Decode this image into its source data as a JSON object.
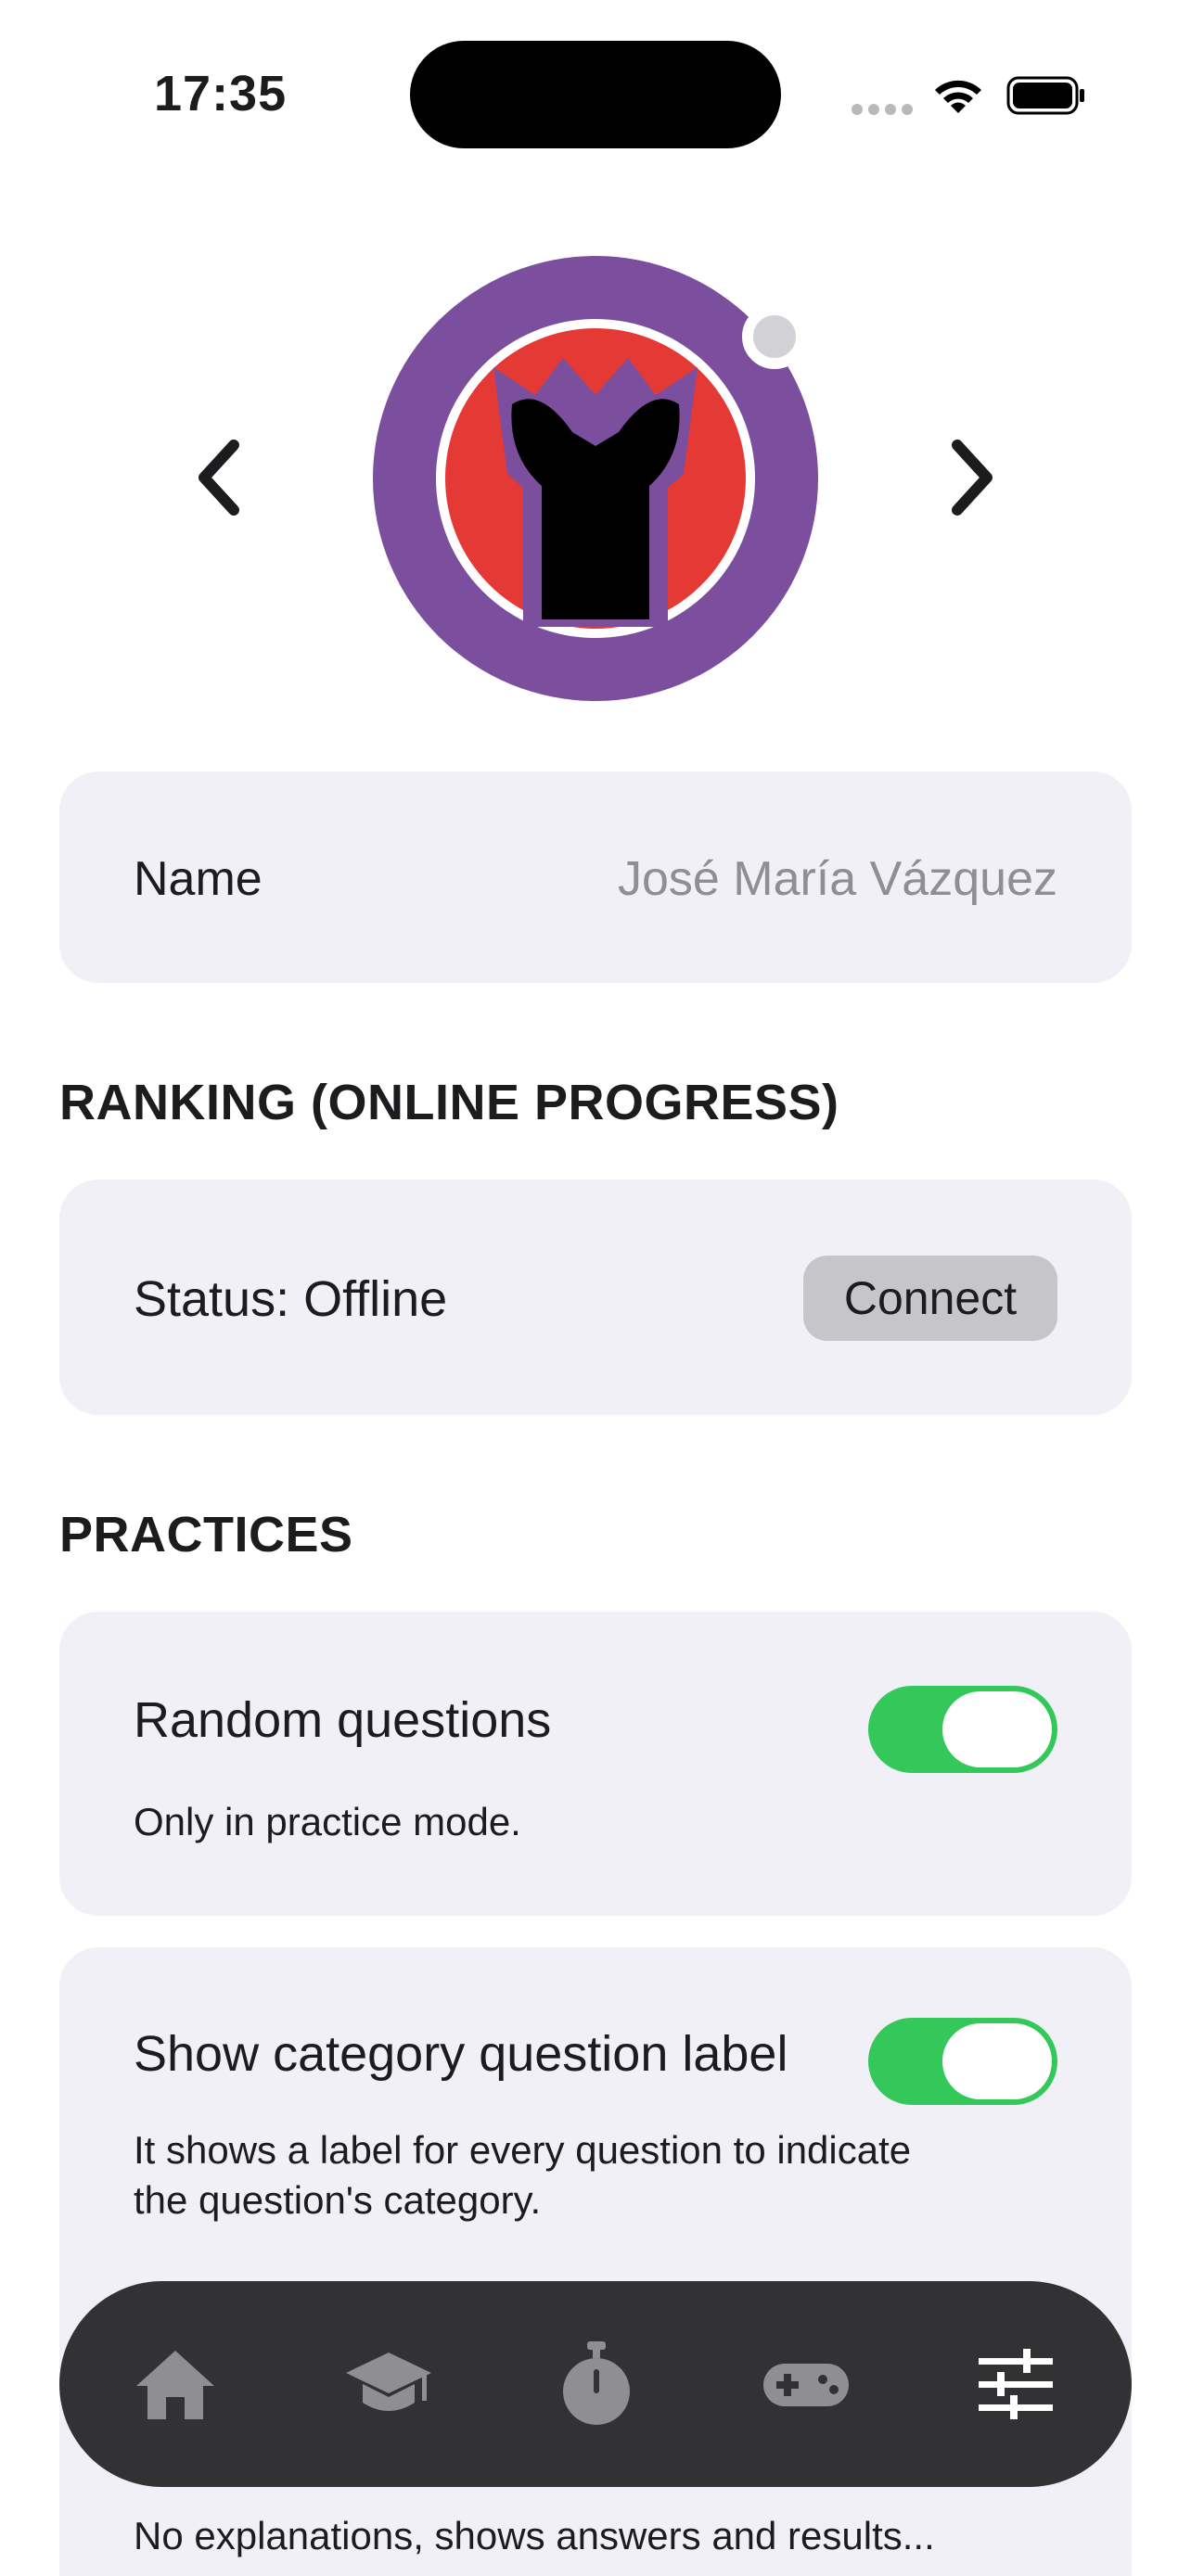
{
  "status_bar": {
    "time": "17:35"
  },
  "avatar": {
    "prev_icon": "chevron-left-icon",
    "next_icon": "chevron-right-icon"
  },
  "profile": {
    "name_label": "Name",
    "name_value": "José María Vázquez"
  },
  "ranking": {
    "section_title": "RANKING (ONLINE PROGRESS)",
    "status_text": "Status: Offline",
    "connect_label": "Connect"
  },
  "practices": {
    "section_title": "PRACTICES",
    "random_questions": {
      "title": "Random questions",
      "description": "Only in practice mode.",
      "enabled": true
    },
    "category_label": {
      "title": "Show category question label",
      "description": "It shows a label for every question to indicate the question's category.",
      "enabled": true
    },
    "partial_option": {
      "description": "No explanations, shows answers and results..."
    }
  },
  "tab_bar": {
    "items": [
      {
        "icon": "home-icon"
      },
      {
        "icon": "graduation-cap-icon"
      },
      {
        "icon": "stopwatch-icon"
      },
      {
        "icon": "gamepad-icon"
      },
      {
        "icon": "sliders-icon",
        "active": true
      }
    ]
  },
  "colors": {
    "accent_green": "#34c759",
    "card_bg": "#f1f0f6",
    "tab_bar_bg": "#323234",
    "avatar_purple": "#7b4f9e",
    "avatar_red": "#e53935"
  }
}
